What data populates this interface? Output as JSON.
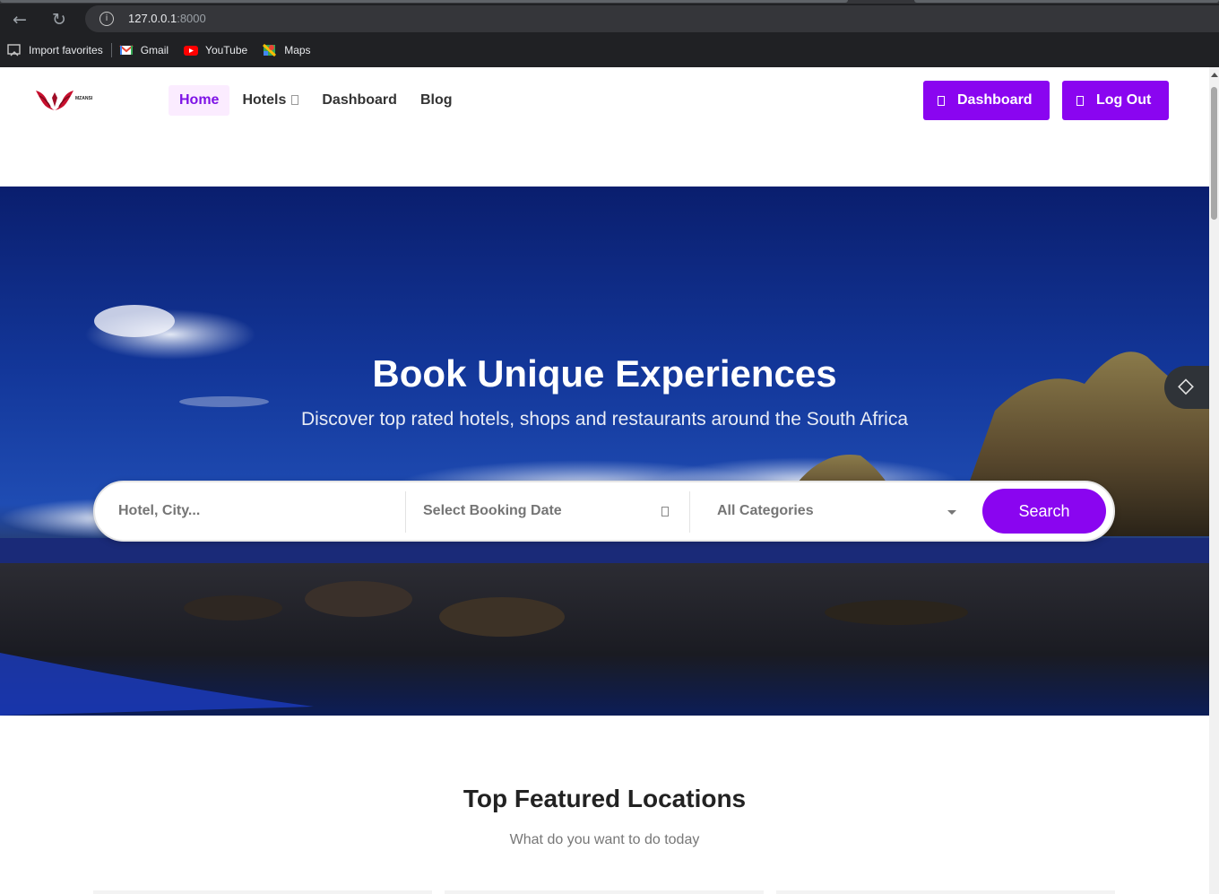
{
  "browser": {
    "url_host": "127.0.0.1",
    "url_port": ":8000",
    "bookmarks": [
      "Import favorites",
      "Gmail",
      "YouTube",
      "Maps"
    ]
  },
  "site": {
    "logo_text": "MZANSI",
    "nav": [
      {
        "label": "Home",
        "active": true
      },
      {
        "label": "Hotels"
      },
      {
        "label": "Dashboard"
      },
      {
        "label": "Blog"
      }
    ],
    "dashboard_button": "Dashboard",
    "logout_button": "Log Out",
    "accent_color": "#8a05f0"
  },
  "hero": {
    "title": "Book Unique Experiences",
    "subtitle": "Discover top rated hotels, shops and restaurants around the South Africa",
    "search": {
      "location_placeholder": "Hotel, City...",
      "date_placeholder": "Select Booking Date",
      "category_selected": "All Categories",
      "button": "Search"
    }
  },
  "featured": {
    "title": "Top Featured Locations",
    "subtitle": "What do you want to do today"
  }
}
